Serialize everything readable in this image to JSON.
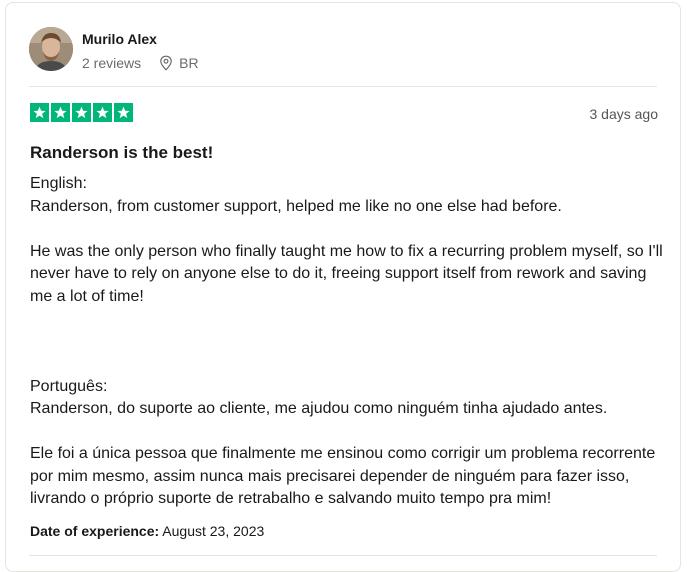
{
  "reviewer": {
    "name": "Murilo Alex",
    "reviews_count": "2 reviews",
    "country": "BR"
  },
  "review": {
    "rating": 5,
    "stars": [
      "★",
      "★",
      "★",
      "★",
      "★"
    ],
    "date_ago": "3 days ago",
    "title": "Randerson is the best!",
    "english_heading": "English:",
    "english_p1": "Randerson, from customer support, helped me like no one else had before.",
    "english_p2": "He was the only person who finally taught me how to fix a recurring problem myself, so I'll never have to rely on anyone else to do it, freeing support itself from rework and saving me a lot of time!",
    "portuguese_heading": "Português:",
    "portuguese_p1": "Randerson, do suporte ao cliente, me ajudou como ninguém tinha ajudado antes.",
    "portuguese_p2": "Ele foi a única pessoa que finalmente me ensinou como corrigir um problema recorrente por mim mesmo, assim nunca mais precisarei depender de ninguém para fazer isso, livrando o próprio suporte de retrabalho e salvando muito tempo pra mim!",
    "experience_label": "Date of experience:",
    "experience_date": "August 23, 2023"
  },
  "colors": {
    "star_green": "#00b67a",
    "text": "#191919",
    "muted": "#6b6b6b"
  },
  "icons": {
    "location": "location-pin-icon",
    "star": "star-icon"
  }
}
